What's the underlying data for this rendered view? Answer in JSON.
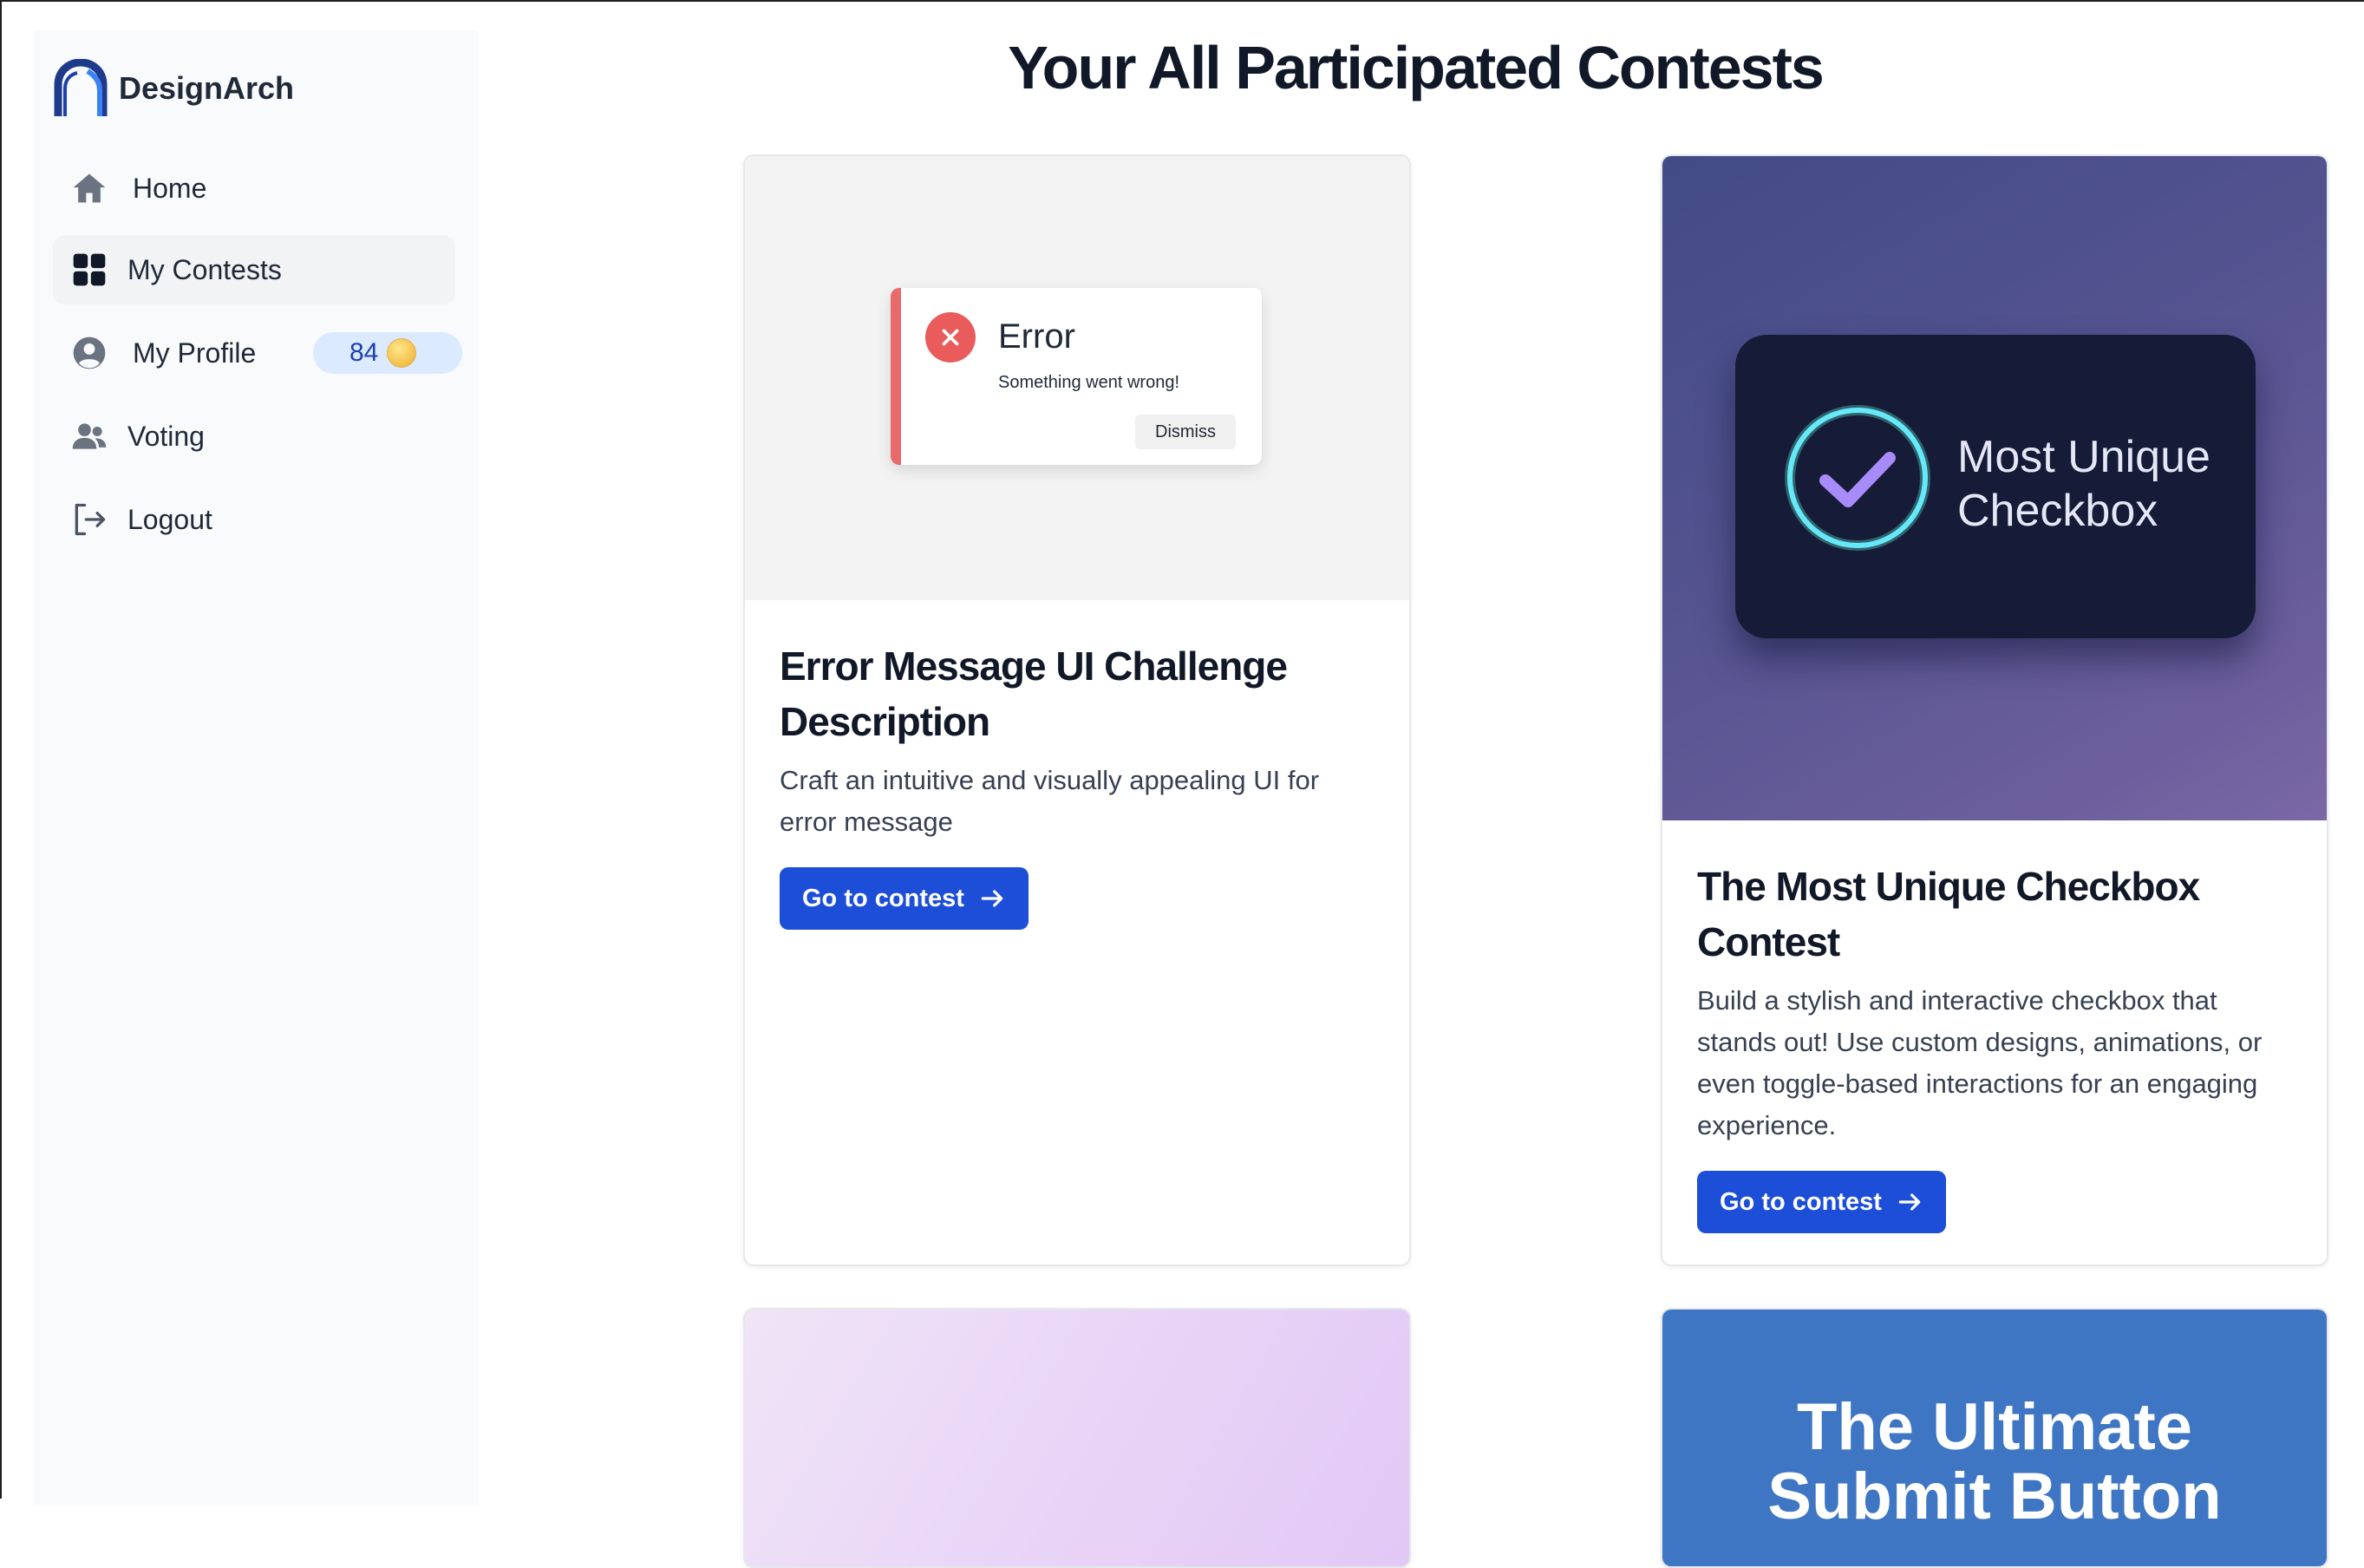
{
  "app": {
    "brand_name": "DesignArch",
    "page_title": "Your All Participated Contests",
    "colors": {
      "primary": "#1d4ed8",
      "sidebar_bg": "#f8fafc",
      "badge_bg": "#dbeafe"
    }
  },
  "sidebar": {
    "items": [
      {
        "label": "Home",
        "icon": "home-icon"
      },
      {
        "label": "My Contests",
        "icon": "grid-icon",
        "active": true
      },
      {
        "label": "My Profile",
        "icon": "user-circle-icon",
        "badge": "84",
        "badge_icon": "coin-icon"
      },
      {
        "label": "Voting",
        "icon": "users-icon"
      },
      {
        "label": "Logout",
        "icon": "logout-icon"
      }
    ]
  },
  "contests": [
    {
      "title": "Error Message UI Challenge Description",
      "description": "Craft an intuitive and visually appealing UI for error message",
      "cta": "Go to contest",
      "preview": {
        "heading": "Error",
        "message": "Something went wrong!",
        "button": "Dismiss"
      }
    },
    {
      "title": "The Most Unique Checkbox Contest",
      "description": "Build a stylish and interactive checkbox that stands out! Use custom designs, animations, or even toggle-based interactions for an engaging experience.",
      "cta": "Go to contest",
      "preview": {
        "line1": "Most Unique",
        "line2": "Checkbox"
      }
    },
    {
      "preview": {}
    },
    {
      "preview": {
        "line1": "The Ultimate",
        "line2": "Submit Button"
      }
    }
  ]
}
